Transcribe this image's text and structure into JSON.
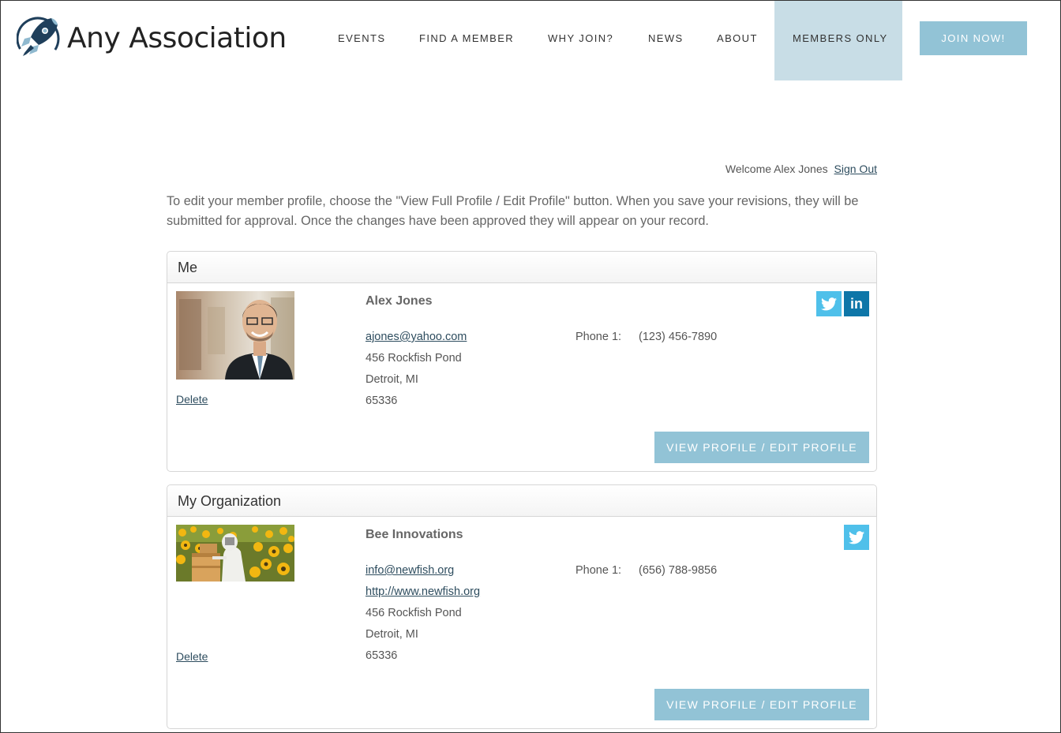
{
  "brand": {
    "name": "Any Association",
    "logo_icon": "rocket-icon"
  },
  "nav": {
    "items": [
      {
        "label": "EVENTS"
      },
      {
        "label": "FIND A MEMBER"
      },
      {
        "label": "WHY JOIN?"
      },
      {
        "label": "NEWS"
      },
      {
        "label": "ABOUT"
      },
      {
        "label": "MEMBERS ONLY",
        "active": true
      }
    ],
    "join_label": "JOIN NOW!"
  },
  "welcome": {
    "text": "Welcome Alex Jones",
    "signout_label": "Sign Out"
  },
  "intro": "To edit your member profile, choose the \"View Full Profile / Edit Profile\" button. When you save your revisions, they will be submitted for approval. Once the changes have been approved they will appear on your record.",
  "me": {
    "heading": "Me",
    "name": "Alex Jones",
    "email": "ajones@yahoo.com",
    "address": "456 Rockfish Pond",
    "city": "Detroit, MI",
    "zip": "65336",
    "phone_label": "Phone 1:",
    "phone": "(123) 456-7890",
    "delete_label": "Delete",
    "edit_label": "VIEW PROFILE / EDIT PROFILE",
    "social": [
      "twitter-icon",
      "linkedin-icon"
    ],
    "linkedin_text": "in"
  },
  "org": {
    "heading": "My Organization",
    "name": "Bee Innovations",
    "email": "info@newfish.org",
    "website": "http://www.newfish.org",
    "address": "456 Rockfish Pond",
    "city": "Detroit, MI",
    "zip": "65336",
    "phone_label": "Phone 1:",
    "phone": "(656) 788-9856",
    "delete_label": "Delete",
    "edit_label": "VIEW PROFILE / EDIT PROFILE",
    "social": [
      "twitter-icon"
    ]
  },
  "colors": {
    "accent": "#92c3d6",
    "active_nav": "#c8dde6",
    "twitter": "#4fc0ea",
    "linkedin": "#0e76a8",
    "link": "#2e4d5f"
  }
}
